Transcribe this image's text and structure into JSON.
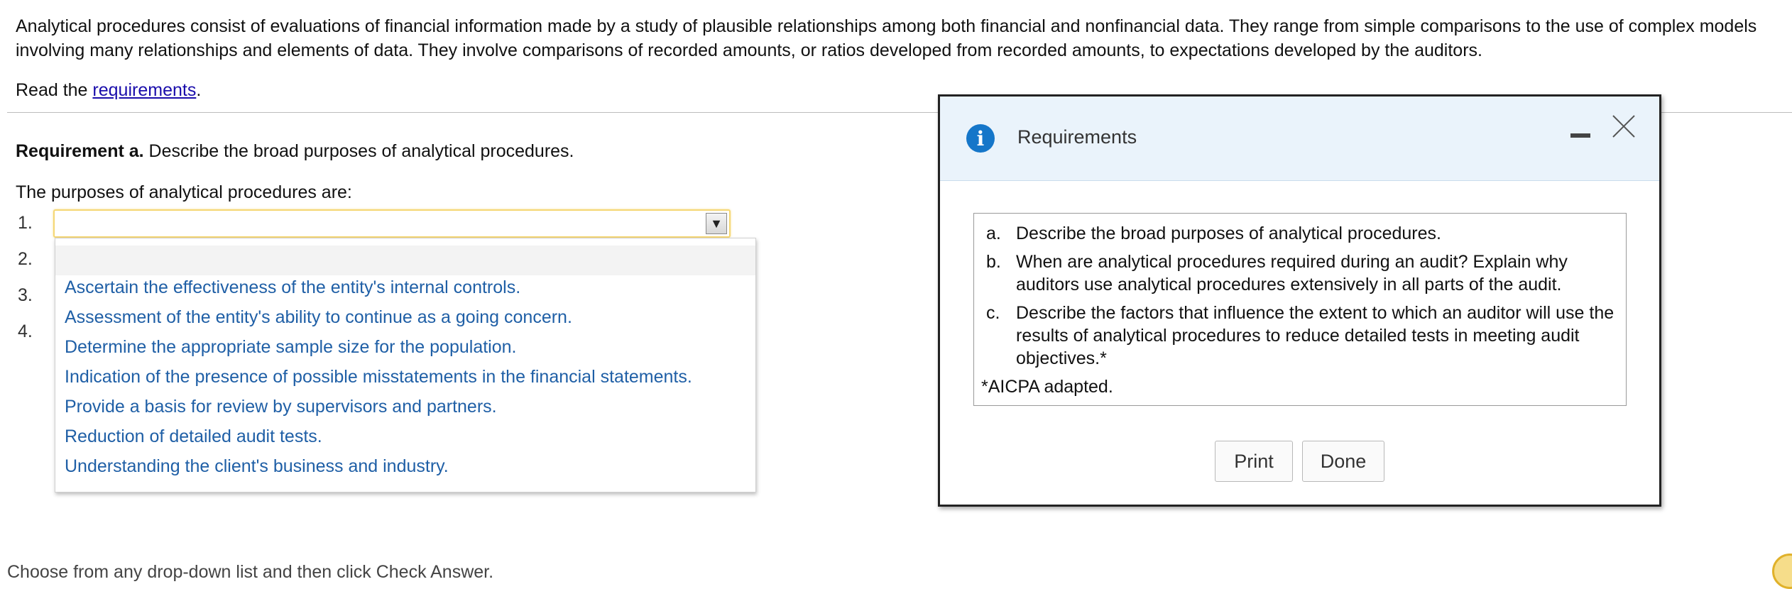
{
  "intro": "Analytical procedures consist of evaluations of financial information made by a study of plausible relationships among both financial and nonfinancial data. They range from simple comparisons to the use of complex models involving many relationships and elements of data. They involve comparisons of recorded amounts, or ratios developed from recorded amounts, to expectations developed by the auditors.",
  "read_prefix": "Read the ",
  "read_link": "requirements",
  "read_suffix": ".",
  "requirement_a_label": "Requirement a.",
  "requirement_a_text": " Describe the broad purposes of analytical procedures.",
  "purposes_label": "The purposes of analytical procedures are:",
  "numbers": [
    "1.",
    "2.",
    "3.",
    "4."
  ],
  "dropdown": {
    "selected": "",
    "arrow": "▼",
    "options": [
      "Ascertain the effectiveness of the entity's internal controls.",
      "Assessment of the entity's ability to continue as a going concern.",
      "Determine the appropriate sample size for the population.",
      "Indication of the presence of possible misstatements in the financial statements.",
      "Provide a basis for review by supervisors and partners.",
      "Reduction of detailed audit tests.",
      "Understanding the client's business and industry."
    ]
  },
  "modal": {
    "title": "Requirements",
    "info_icon": "i",
    "items": [
      {
        "label": "a.",
        "text": "Describe the broad purposes of analytical procedures."
      },
      {
        "label": "b.",
        "text": "When are analytical procedures required during an audit? Explain why auditors use analytical procedures extensively in all parts of the audit."
      },
      {
        "label": "c.",
        "text": "Describe the factors that influence the extent to which an auditor will use the results of analytical procedures to reduce detailed tests in meeting audit objectives.*"
      }
    ],
    "footnote": "*AICPA adapted.",
    "print_label": "Print",
    "done_label": "Done"
  },
  "bottom_text": "Choose from any drop-down list and then click Check Answer."
}
